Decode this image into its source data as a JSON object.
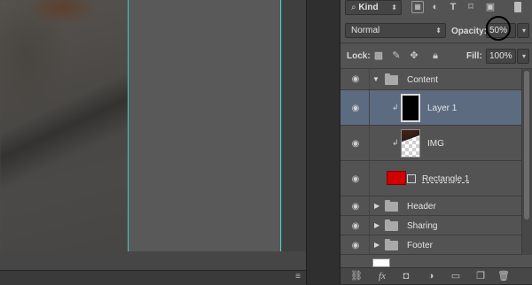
{
  "filter": {
    "kind_label": "Kind",
    "icons": [
      "image-filter-icon",
      "adjustment-filter-icon",
      "type-filter-icon",
      "shape-filter-icon",
      "smart-object-filter-icon"
    ]
  },
  "blend": {
    "mode": "Normal",
    "opacity_label": "Opacity:",
    "opacity_value": "50%"
  },
  "lock": {
    "label": "Lock:",
    "icons": [
      "lock-transparent-icon",
      "lock-image-icon",
      "lock-position-icon",
      "lock-all-icon"
    ],
    "fill_label": "Fill:",
    "fill_value": "100%"
  },
  "layers": [
    {
      "name": "Content",
      "type": "group",
      "expanded": true
    },
    {
      "name": "Layer 1",
      "type": "layer",
      "selected": true,
      "clipped": true
    },
    {
      "name": "IMG",
      "type": "layer",
      "clipped": true
    },
    {
      "name": "Rectangle 1",
      "type": "shape"
    },
    {
      "name": "Header",
      "type": "group",
      "expanded": false
    },
    {
      "name": "Sharing",
      "type": "group",
      "expanded": false
    },
    {
      "name": "Footer",
      "type": "group",
      "expanded": false
    }
  ],
  "bottom_toolbar": [
    "link-icon",
    "fx",
    "mask-icon",
    "adjustment-icon",
    "new-group-icon",
    "new-layer-icon",
    "trash-icon"
  ],
  "colors": {
    "guide": "#3ad0d0",
    "selected_row": "#5d6b80",
    "rectangle_fill": "#d00000"
  }
}
